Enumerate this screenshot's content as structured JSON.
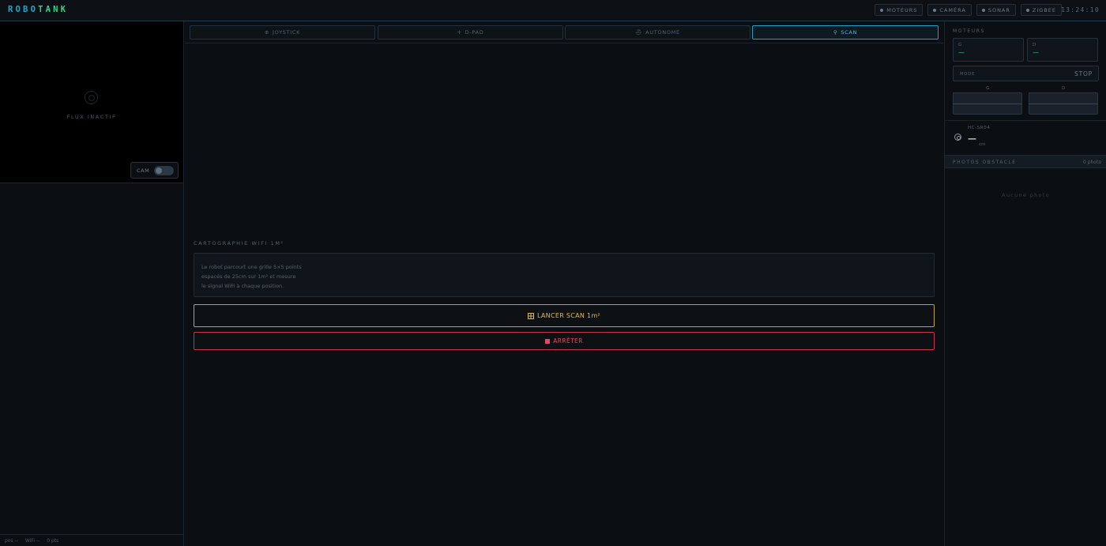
{
  "header": {
    "logo_part1": "ROBO",
    "logo_part2": "TANK",
    "status": [
      {
        "label": "MOTEURS"
      },
      {
        "label": "CAMÉRA"
      },
      {
        "label": "SONAR"
      },
      {
        "label": "ZIGBEE"
      }
    ],
    "clock": "13:24:10"
  },
  "camera": {
    "status_text": "FLUX INACTIF",
    "toggle_label": "CAM",
    "toggle_on": false
  },
  "left_footer": {
    "pos": "pos --",
    "wifi": "WiFi --",
    "pts": "0 pts"
  },
  "tabs": [
    {
      "icon": "⊕",
      "label": "JOYSTICK",
      "active": false
    },
    {
      "icon": "✛",
      "label": "D-PAD",
      "active": false
    },
    {
      "icon": "⛑",
      "label": "AUTONOME",
      "active": false
    },
    {
      "icon": "⚲",
      "label": "SCAN",
      "active": true
    }
  ],
  "scan": {
    "title": "CARTOGRAPHIE WIFI 1M²",
    "description": [
      "Le robot parcourt une grille 5×5 points",
      "espacés de 25cm sur 1m² et mesure",
      "le signal WiFi à chaque position."
    ],
    "launch_label": "LANCER SCAN 1m²",
    "stop_label": "ARRÊTER"
  },
  "motors": {
    "title": "MOTEURS",
    "left_label": "G",
    "left_value": "—",
    "right_label": "D",
    "right_value": "—",
    "mode_label": "MODE",
    "mode_value": "STOP",
    "bar_left_label": "G",
    "bar_right_label": "D"
  },
  "sonar": {
    "sensor_label": "HC-SR04",
    "value": "—",
    "unit": "cm"
  },
  "photos": {
    "title": "PHOTOS OBSTACLE",
    "count": "0 photo",
    "empty_text": "Aucune photo"
  },
  "colors": {
    "accent": "#1ea7c8",
    "logo_green": "#2bd48a",
    "scan_button": "#e3b84c",
    "stop_button": "#e14a66"
  }
}
